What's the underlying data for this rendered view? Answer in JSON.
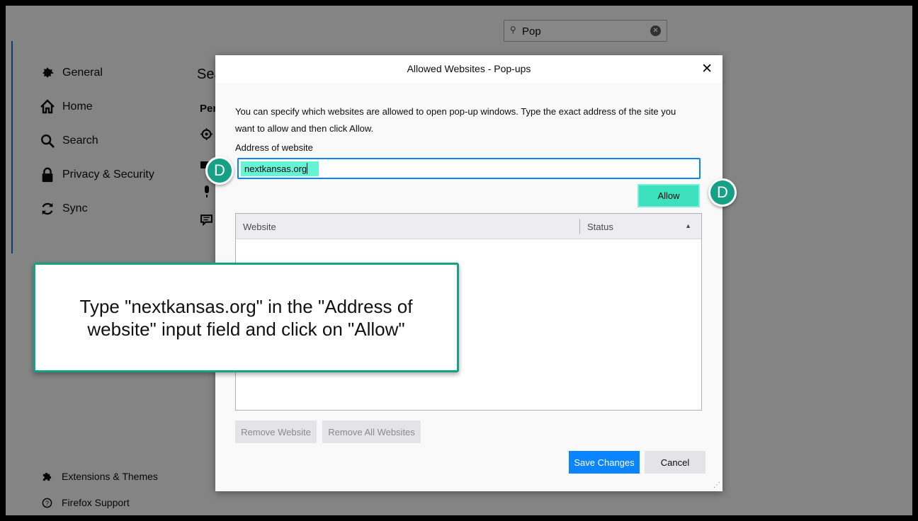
{
  "search": {
    "value": "Pop",
    "clear_icon": "close-circle-icon",
    "icon": "search-icon"
  },
  "sidebar": {
    "items": [
      {
        "label": "General",
        "icon": "gear-icon"
      },
      {
        "label": "Home",
        "icon": "home-icon"
      },
      {
        "label": "Search",
        "icon": "search-icon"
      },
      {
        "label": "Privacy & Security",
        "icon": "lock-icon"
      },
      {
        "label": "Sync",
        "icon": "sync-icon"
      }
    ],
    "footer": [
      {
        "label": "Extensions & Themes",
        "icon": "puzzle-icon"
      },
      {
        "label": "Firefox Support",
        "icon": "help-icon"
      }
    ]
  },
  "background": {
    "heading_peek": "Sea",
    "subheading_peek": "Per"
  },
  "dialog": {
    "title": "Allowed Websites - Pop-ups",
    "description": "You can specify which websites are allowed to open pop-up windows. Type the exact address of the site you want to allow and then click Allow.",
    "address_label": "Address of website",
    "address_value": "nextkansas.org",
    "allow_label": "Allow",
    "table": {
      "columns": [
        "Website",
        "Status"
      ],
      "rows": []
    },
    "remove_website_label": "Remove Website",
    "remove_all_label": "Remove All Websites",
    "save_label": "Save Changes",
    "cancel_label": "Cancel"
  },
  "tutorial": {
    "badge_letter": "D",
    "instruction": "Type \"nextkansas.org\" in the \"Address of website\" input field and click on \"Allow\"",
    "accent_color": "#16a085",
    "highlight_color": "#3de0bc"
  }
}
